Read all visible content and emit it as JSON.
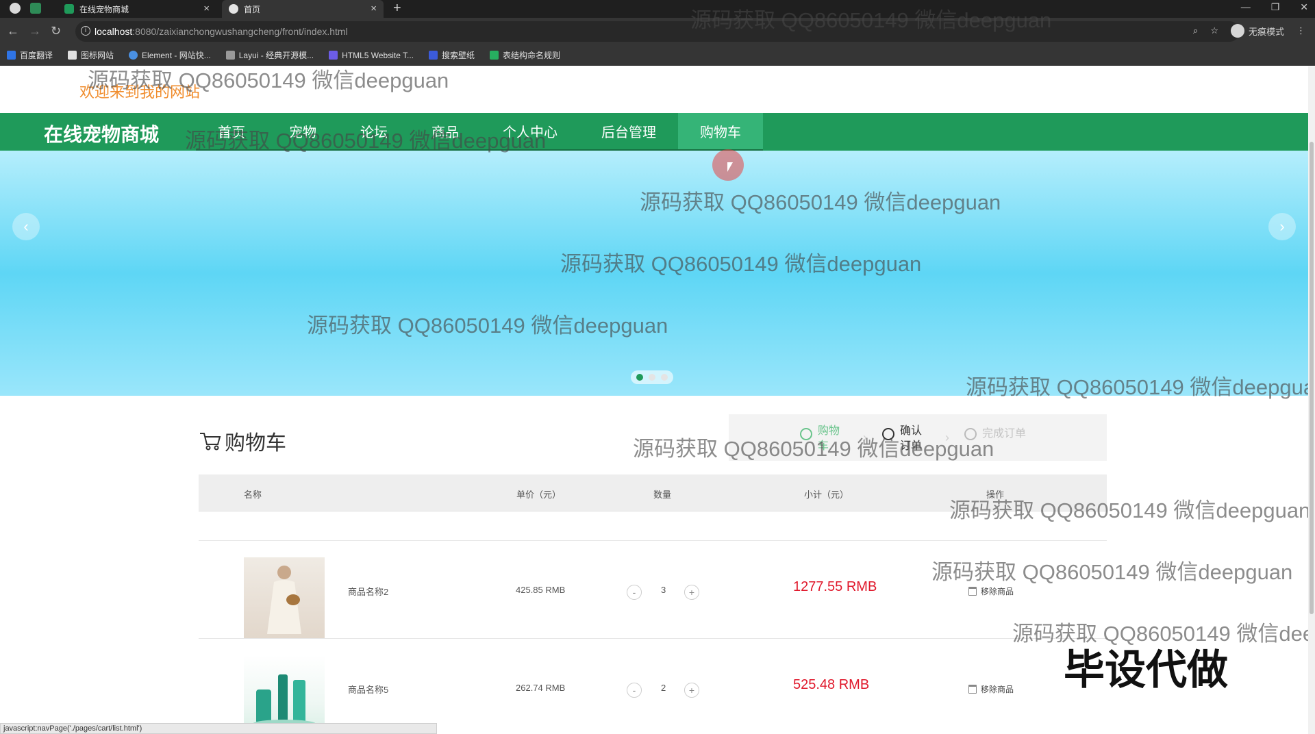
{
  "browser": {
    "tabs": [
      {
        "title": "在线宠物商城",
        "active": false
      },
      {
        "title": "首页",
        "active": true
      }
    ],
    "url_host": "localhost",
    "url_path": ":8080/zaixianchongwushangcheng/front/index.html",
    "incognito_label": "无痕模式",
    "bookmarks": [
      "百度翻译",
      "图标网站",
      "Element - 网站快...",
      "Layui - 经典开源模...",
      "HTML5 Website T...",
      "搜索壁纸",
      "表结构命名规则"
    ]
  },
  "header": {
    "welcome": "欢迎来到我的网站",
    "site_title": "在线宠物商城",
    "nav": [
      "首页",
      "宠物",
      "论坛",
      "商品",
      "个人中心",
      "后台管理",
      "购物车"
    ],
    "active_nav": "购物车"
  },
  "carousel": {
    "slides": 3,
    "active_slide": 1
  },
  "cart": {
    "title": "购物车",
    "steps": [
      "购物车",
      "确认订单",
      "完成订单"
    ],
    "step_states": [
      "done",
      "current",
      "todo"
    ],
    "columns": [
      "名称",
      "单价（元）",
      "数量",
      "小计（元）",
      "操作"
    ],
    "items": [
      {
        "name": "商品名称2",
        "price": "425.85 RMB",
        "qty": "3",
        "subtotal": "1277.55 RMB",
        "action": "移除商品"
      },
      {
        "name": "商品名称5",
        "price": "262.74 RMB",
        "qty": "2",
        "subtotal": "525.48 RMB",
        "action": "移除商品"
      }
    ],
    "minus_label": "-",
    "plus_label": "+"
  },
  "statusbar": "javascript:navPage('./pages/cart/list.html')",
  "watermark": "源码获取 QQ86050149 微信deepguan",
  "badge": "毕设代做",
  "colors": {
    "nav_green": "#1f9a5a",
    "active_nav": "#35b477",
    "welcome_orange": "#f08d2e",
    "price_red": "#e0182b"
  }
}
